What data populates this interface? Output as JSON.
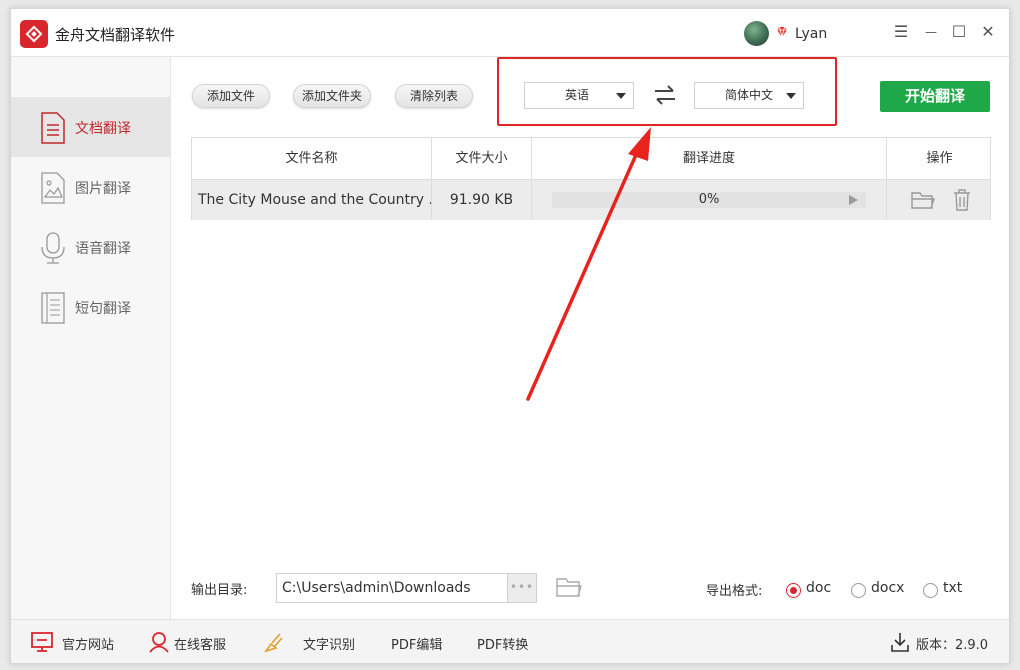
{
  "app": {
    "title": "金舟文档翻译软件"
  },
  "user": {
    "name": "Lyan"
  },
  "window_controls": {
    "menu": "☰",
    "minimize": "—",
    "maximize": "☐",
    "close": "✕"
  },
  "sidebar": {
    "items": [
      {
        "label": "文档翻译",
        "icon": "document-icon",
        "active": true
      },
      {
        "label": "图片翻译",
        "icon": "image-icon",
        "active": false
      },
      {
        "label": "语音翻译",
        "icon": "microphone-icon",
        "active": false
      },
      {
        "label": "短句翻译",
        "icon": "text-icon",
        "active": false
      }
    ]
  },
  "toolbar": {
    "add_file": "添加文件",
    "add_folder": "添加文件夹",
    "clear_list": "清除列表",
    "source_lang": "英语",
    "target_lang": "简体中文",
    "start": "开始翻译"
  },
  "table": {
    "columns": [
      "文件名称",
      "文件大小",
      "翻译进度",
      "操作"
    ],
    "rows": [
      {
        "name": "The City Mouse and the Country ...",
        "size": "91.90 KB",
        "progress_text": "0%",
        "progress": 0
      }
    ]
  },
  "output": {
    "label": "输出目录:",
    "path": "C:\\Users\\admin\\Downloads",
    "browse": "•••",
    "format_label": "导出格式:",
    "formats": [
      {
        "label": "doc",
        "checked": true
      },
      {
        "label": "docx",
        "checked": false
      },
      {
        "label": "txt",
        "checked": false
      }
    ]
  },
  "footer": {
    "website": "官方网站",
    "service": "在线客服",
    "ocr": "文字识别",
    "pdf_edit": "PDF编辑",
    "pdf_convert": "PDF转换",
    "version": "版本：2.9.0"
  },
  "colors": {
    "brand_red": "#d9262c",
    "start_green": "#1fa847",
    "highlight_red": "#e02424"
  }
}
